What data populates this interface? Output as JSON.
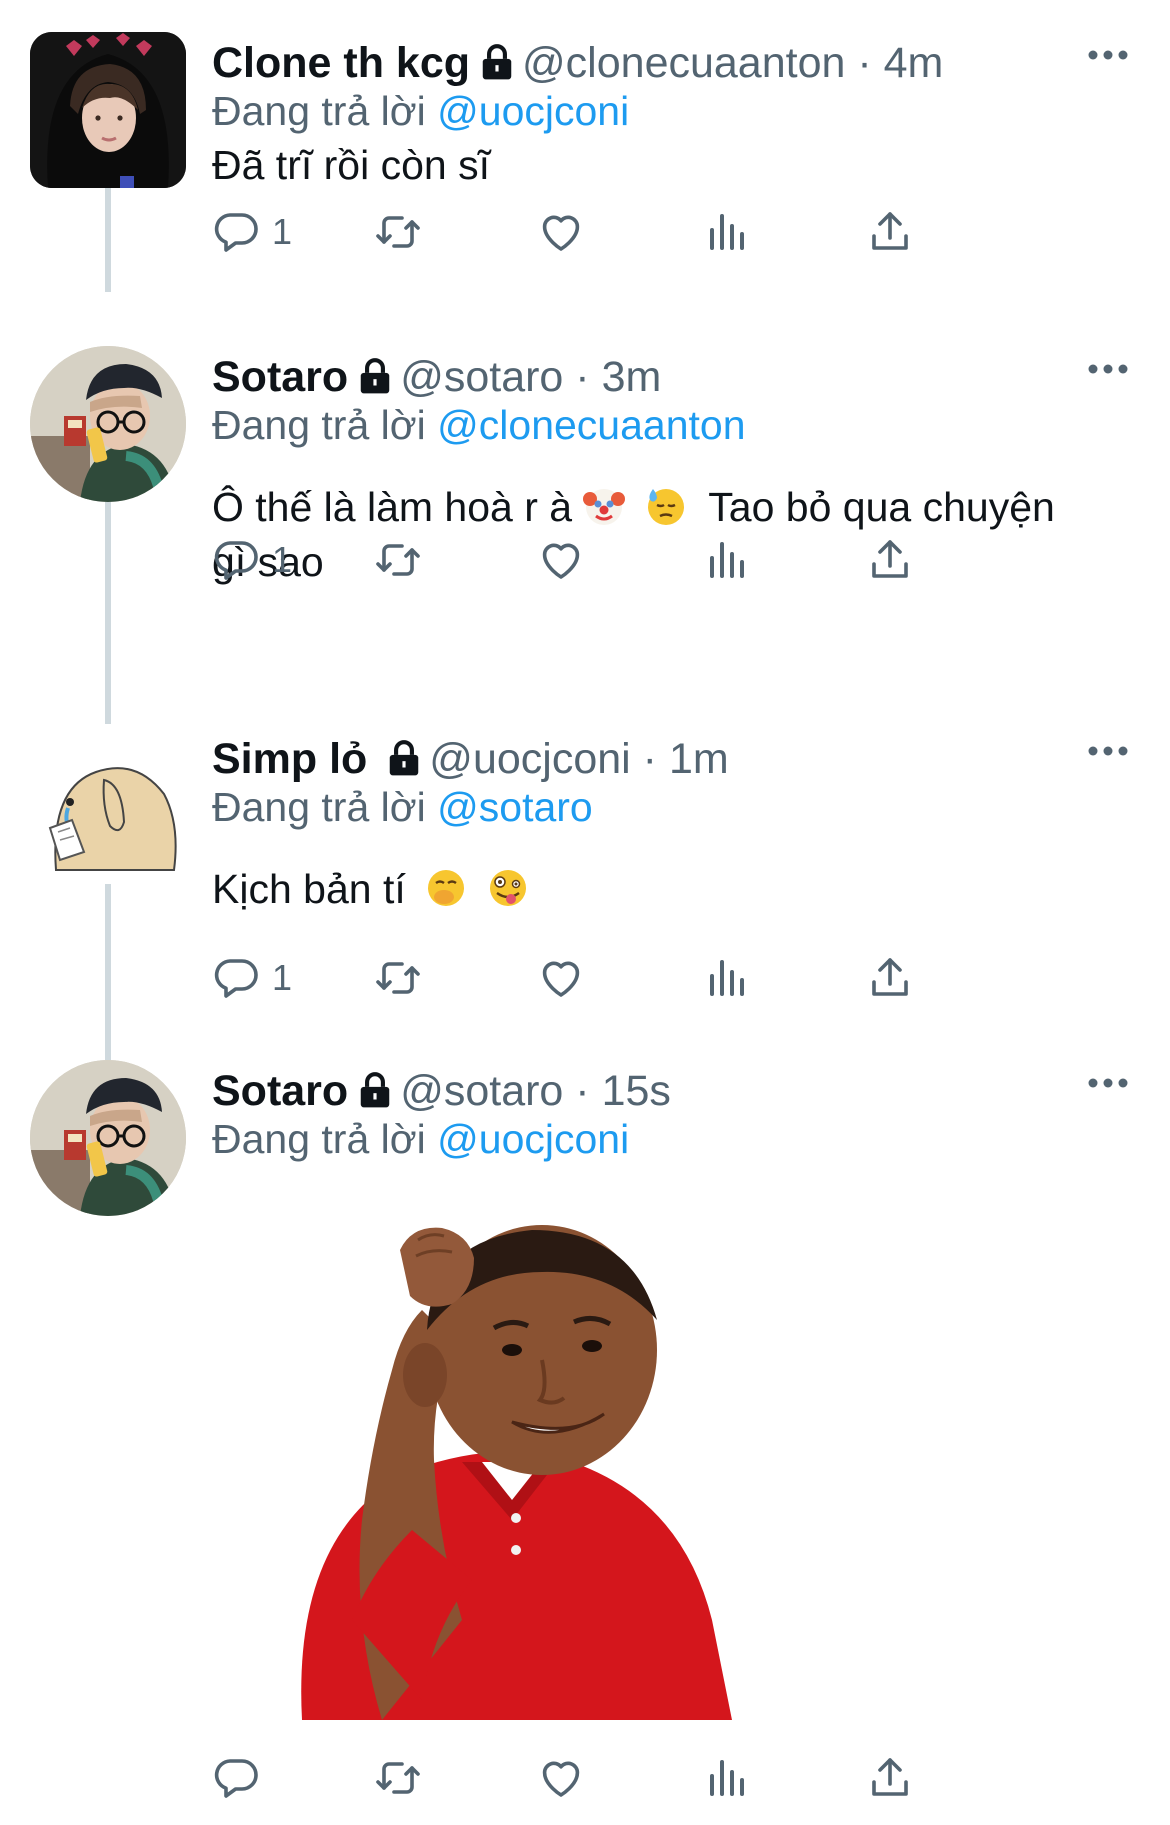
{
  "tweets": [
    {
      "name": "Clone th kcg",
      "handle": "@clonecuaanton",
      "time": "4m",
      "replying_prefix": "Đang trả lời",
      "replying_to": "@uocjconi",
      "text": "Đã trĩ rồi còn sĩ",
      "reply_count": "1",
      "avatar_icon": "avatar-hooded-person"
    },
    {
      "name": "Sotaro",
      "handle": "@sotaro",
      "time": "3m",
      "replying_prefix": "Đang trả lời",
      "replying_to": "@clonecuaanton",
      "text_a": "Ô thế là làm hoà r à",
      "emoji_1": "clown-face-emoji",
      "emoji_2": "downcast-sweat-emoji",
      "text_b": "Tao bỏ qua chuyện",
      "text_c": "gì sao",
      "reply_count": "1",
      "avatar_icon": "avatar-cap-glasses"
    },
    {
      "name": "Simp lỏ",
      "handle": "@uocjconi",
      "time": "1m",
      "replying_prefix": "Đang trả lời",
      "replying_to": "@sotaro",
      "text": "Kịch bản tí",
      "emoji_1": "hand-over-mouth-emoji",
      "emoji_2": "zany-face-emoji",
      "reply_count": "1",
      "avatar_icon": "avatar-crying-dog"
    },
    {
      "name": "Sotaro",
      "handle": "@sotaro",
      "time": "15s",
      "replying_prefix": "Đang trả lời",
      "replying_to": "@uocjconi",
      "media": "boy-scratching-head-meme",
      "avatar_icon": "avatar-cap-glasses"
    }
  ],
  "separator": " · ",
  "icons": {
    "reply": "speech-bubble-icon",
    "retweet": "retweet-icon",
    "like": "heart-icon",
    "views": "bar-chart-icon",
    "share": "share-icon",
    "more": "more-dots-icon",
    "lock": "lock-icon"
  },
  "colors": {
    "link": "#1d9bf0",
    "secondary_text": "#536471",
    "primary_text": "#0f1419",
    "thread_line": "#cfd9de"
  }
}
